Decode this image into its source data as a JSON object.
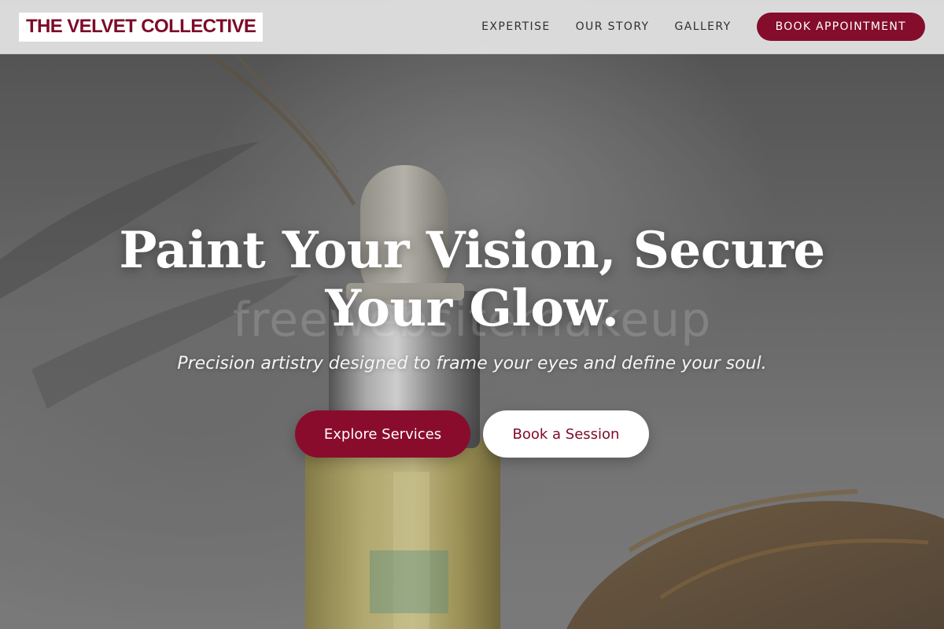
{
  "brand": {
    "name": "THE VELVET COLLECTIVE",
    "color": "#7d0a28"
  },
  "nav": {
    "links": [
      "EXPERTISE",
      "OUR STORY",
      "GALLERY"
    ],
    "cta_label": "BOOK APPOINTMENT",
    "cta_color": "#840d2c"
  },
  "hero": {
    "headline_line1": "Paint Your Vision, Secure",
    "headline_line2": "Your Glow.",
    "watermark": "freewebsitemakeup",
    "subheadline": "Precision artistry designed to frame your eyes and define your soul.",
    "primary_button": "Explore Services",
    "secondary_button": "Book a Session",
    "background_image": "serum-dropper-bottle-photo"
  }
}
